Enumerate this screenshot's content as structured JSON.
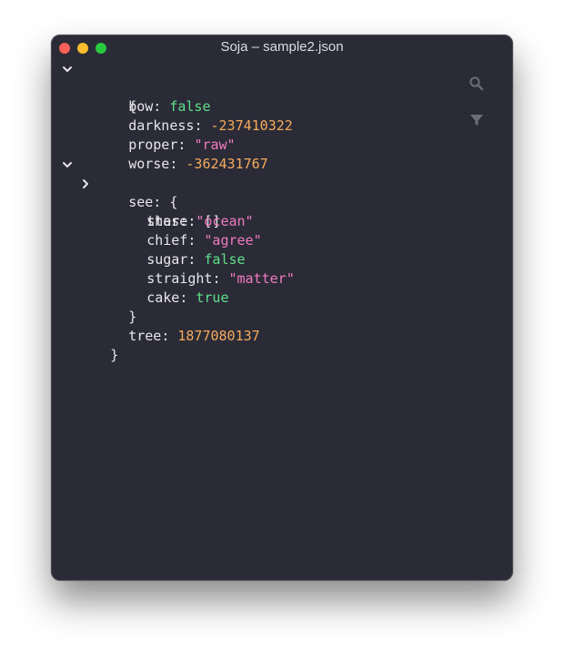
{
  "window": {
    "title": "Soja – sample2.json"
  },
  "toolbar": {
    "search_icon": "search-icon",
    "filter_icon": "filter-icon"
  },
  "colors": {
    "background": "#2a2b36",
    "string": "#f07ac2",
    "number": "#f5aa5d",
    "boolean": "#5fe08a",
    "text": "#e6e6ea",
    "icon": "#6b6c78"
  },
  "tree": {
    "root_open": "{",
    "root_close": "}",
    "bow": {
      "key": "bow",
      "sep": ": ",
      "value": "false"
    },
    "darkness": {
      "key": "darkness",
      "sep": ": ",
      "value": "-237410322"
    },
    "proper": {
      "key": "proper",
      "sep": ": ",
      "value": "\"raw\""
    },
    "worse": {
      "key": "worse",
      "sep": ": ",
      "value": "-362431767"
    },
    "see": {
      "key": "see",
      "sep": ": ",
      "open": "{",
      "close": "}",
      "these": {
        "key": "these",
        "sep": ": ",
        "value": "[]"
      },
      "star": {
        "key": "star",
        "sep": ": ",
        "value": "\"ocean\""
      },
      "chief": {
        "key": "chief",
        "sep": ": ",
        "value": "\"agree\""
      },
      "sugar": {
        "key": "sugar",
        "sep": ": ",
        "value": "false"
      },
      "straight": {
        "key": "straight",
        "sep": ": ",
        "value": "\"matter\""
      },
      "cake": {
        "key": "cake",
        "sep": ": ",
        "value": "true"
      }
    },
    "tree": {
      "key": "tree",
      "sep": ": ",
      "value": "1877080137"
    }
  }
}
